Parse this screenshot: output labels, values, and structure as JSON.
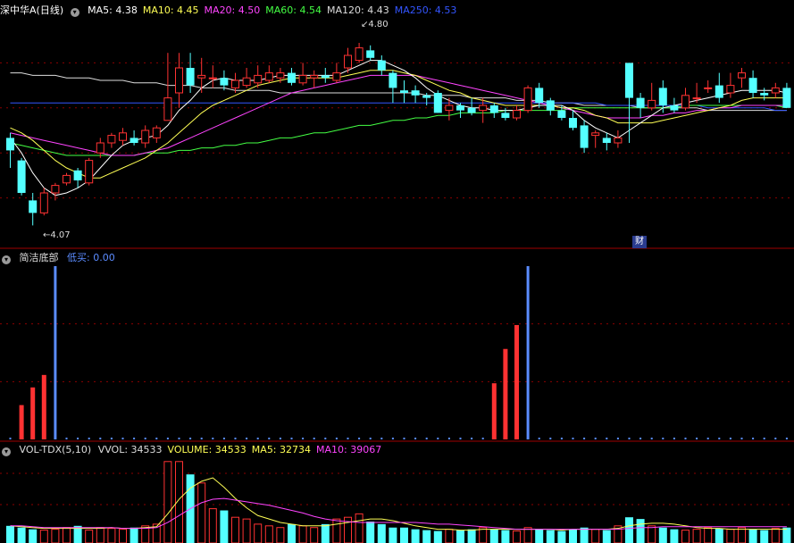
{
  "main_panel": {
    "title": "深中华A(日线)",
    "ma": [
      {
        "label": "MA5: 4.38",
        "color": "#ffffff"
      },
      {
        "label": "MA10: 4.45",
        "color": "#ffff55"
      },
      {
        "label": "MA20: 4.50",
        "color": "#ff44ff"
      },
      {
        "label": "MA60: 4.54",
        "color": "#44ff44"
      },
      {
        "label": "MA120: 4.43",
        "color": "#dddddd"
      },
      {
        "label": "MA250: 4.53",
        "color": "#3355ff"
      }
    ],
    "high_label": "4.80",
    "low_label": "4.07",
    "badge": "财"
  },
  "indicator_panel": {
    "name": "简洁底部",
    "value_label": "低买: 0.00",
    "value_color": "#5b8cff"
  },
  "volume_panel": {
    "name": "VOL-TDX(5,10)",
    "items": [
      {
        "label": "VVOL: 34533",
        "color": "#dddddd"
      },
      {
        "label": "VOLUME: 34533",
        "color": "#ffff55"
      },
      {
        "label": "MA5: 32734",
        "color": "#ffff55"
      },
      {
        "label": "MA10: 39067",
        "color": "#ff44ff"
      }
    ]
  },
  "colors": {
    "up": "#ff3232",
    "down": "#54ffff",
    "grid": "#8b0000",
    "buy_line": "#5b8cff"
  },
  "chart_data": {
    "type": "candlestick",
    "price_range": [
      4.0,
      4.9
    ],
    "candles": [
      [
        4.42,
        4.37,
        4.44,
        4.3
      ],
      [
        4.33,
        4.2,
        4.34,
        4.19
      ],
      [
        4.17,
        4.12,
        4.2,
        4.07
      ],
      [
        4.12,
        4.2,
        4.22,
        4.11
      ],
      [
        4.2,
        4.23,
        4.24,
        4.17
      ],
      [
        4.24,
        4.27,
        4.28,
        4.23
      ],
      [
        4.29,
        4.25,
        4.3,
        4.22
      ],
      [
        4.24,
        4.33,
        4.34,
        4.23
      ],
      [
        4.36,
        4.4,
        4.42,
        4.34
      ],
      [
        4.4,
        4.43,
        4.44,
        4.38
      ],
      [
        4.41,
        4.44,
        4.46,
        4.39
      ],
      [
        4.42,
        4.4,
        4.45,
        4.39
      ],
      [
        4.4,
        4.45,
        4.47,
        4.38
      ],
      [
        4.42,
        4.46,
        4.47,
        4.4
      ],
      [
        4.49,
        4.58,
        4.76,
        4.49
      ],
      [
        4.6,
        4.7,
        4.76,
        4.54
      ],
      [
        4.7,
        4.63,
        4.76,
        4.6
      ],
      [
        4.66,
        4.67,
        4.74,
        4.6
      ],
      [
        4.66,
        4.66,
        4.71,
        4.62
      ],
      [
        4.66,
        4.63,
        4.69,
        4.61
      ],
      [
        4.62,
        4.65,
        4.68,
        4.6
      ],
      [
        4.63,
        4.66,
        4.7,
        4.62
      ],
      [
        4.64,
        4.67,
        4.71,
        4.62
      ],
      [
        4.65,
        4.68,
        4.71,
        4.64
      ],
      [
        4.66,
        4.68,
        4.7,
        4.64
      ],
      [
        4.68,
        4.64,
        4.7,
        4.63
      ],
      [
        4.64,
        4.67,
        4.72,
        4.63
      ],
      [
        4.66,
        4.67,
        4.69,
        4.62
      ],
      [
        4.67,
        4.66,
        4.7,
        4.64
      ],
      [
        4.65,
        4.68,
        4.72,
        4.64
      ],
      [
        4.7,
        4.75,
        4.78,
        4.68
      ],
      [
        4.73,
        4.78,
        4.8,
        4.72
      ],
      [
        4.77,
        4.74,
        4.79,
        4.73
      ],
      [
        4.73,
        4.69,
        4.75,
        4.67
      ],
      [
        4.68,
        4.62,
        4.69,
        4.56
      ],
      [
        4.61,
        4.6,
        4.65,
        4.56
      ],
      [
        4.61,
        4.59,
        4.63,
        4.56
      ],
      [
        4.59,
        4.58,
        4.6,
        4.55
      ],
      [
        4.6,
        4.52,
        4.61,
        4.52
      ],
      [
        4.53,
        4.55,
        4.58,
        4.49
      ],
      [
        4.55,
        4.53,
        4.56,
        4.5
      ],
      [
        4.54,
        4.52,
        4.58,
        4.51
      ],
      [
        4.53,
        4.55,
        4.58,
        4.48
      ],
      [
        4.55,
        4.52,
        4.56,
        4.5
      ],
      [
        4.52,
        4.5,
        4.54,
        4.49
      ],
      [
        4.5,
        4.53,
        4.55,
        4.49
      ],
      [
        4.53,
        4.62,
        4.63,
        4.52
      ],
      [
        4.62,
        4.56,
        4.64,
        4.54
      ],
      [
        4.57,
        4.53,
        4.58,
        4.51
      ],
      [
        4.53,
        4.5,
        4.55,
        4.49
      ],
      [
        4.5,
        4.46,
        4.53,
        4.45
      ],
      [
        4.47,
        4.38,
        4.49,
        4.36
      ],
      [
        4.43,
        4.44,
        4.45,
        4.38
      ],
      [
        4.42,
        4.4,
        4.44,
        4.37
      ],
      [
        4.4,
        4.42,
        4.45,
        4.38
      ],
      [
        4.72,
        4.58,
        4.72,
        4.4
      ],
      [
        4.58,
        4.54,
        4.6,
        4.5
      ],
      [
        4.54,
        4.57,
        4.64,
        4.53
      ],
      [
        4.62,
        4.55,
        4.65,
        4.52
      ],
      [
        4.55,
        4.53,
        4.58,
        4.52
      ],
      [
        4.54,
        4.59,
        4.62,
        4.53
      ],
      [
        4.58,
        4.58,
        4.64,
        4.56
      ],
      [
        4.62,
        4.62,
        4.65,
        4.6
      ],
      [
        4.63,
        4.58,
        4.68,
        4.56
      ],
      [
        4.6,
        4.63,
        4.68,
        4.58
      ],
      [
        4.66,
        4.68,
        4.7,
        4.62
      ],
      [
        4.66,
        4.6,
        4.69,
        4.58
      ],
      [
        4.6,
        4.59,
        4.62,
        4.57
      ],
      [
        4.6,
        4.62,
        4.64,
        4.58
      ],
      [
        4.62,
        4.54,
        4.64,
        4.54
      ]
    ],
    "ma5": [
      4.42,
      4.36,
      4.28,
      4.22,
      4.19,
      4.2,
      4.22,
      4.25,
      4.3,
      4.35,
      4.39,
      4.41,
      4.42,
      4.43,
      4.47,
      4.53,
      4.57,
      4.62,
      4.65,
      4.66,
      4.65,
      4.65,
      4.65,
      4.66,
      4.67,
      4.67,
      4.67,
      4.67,
      4.67,
      4.67,
      4.69,
      4.71,
      4.73,
      4.73,
      4.71,
      4.69,
      4.66,
      4.62,
      4.59,
      4.57,
      4.55,
      4.54,
      4.54,
      4.53,
      4.53,
      4.53,
      4.54,
      4.55,
      4.55,
      4.55,
      4.53,
      4.49,
      4.46,
      4.44,
      4.42,
      4.45,
      4.48,
      4.51,
      4.54,
      4.55,
      4.56,
      4.57,
      4.58,
      4.59,
      4.6,
      4.61,
      4.61,
      4.61,
      4.61,
      4.6
    ],
    "ma10": [
      4.46,
      4.44,
      4.41,
      4.37,
      4.33,
      4.3,
      4.28,
      4.26,
      4.26,
      4.28,
      4.3,
      4.32,
      4.34,
      4.37,
      4.4,
      4.44,
      4.48,
      4.52,
      4.55,
      4.57,
      4.59,
      4.61,
      4.63,
      4.64,
      4.65,
      4.66,
      4.66,
      4.66,
      4.66,
      4.66,
      4.67,
      4.68,
      4.69,
      4.69,
      4.69,
      4.68,
      4.67,
      4.65,
      4.63,
      4.61,
      4.6,
      4.58,
      4.57,
      4.56,
      4.55,
      4.55,
      4.55,
      4.55,
      4.55,
      4.54,
      4.54,
      4.53,
      4.51,
      4.5,
      4.48,
      4.48,
      4.48,
      4.48,
      4.49,
      4.5,
      4.51,
      4.52,
      4.53,
      4.54,
      4.55,
      4.57,
      4.58,
      4.58,
      4.58,
      4.58
    ],
    "ma20": [
      4.44,
      4.43,
      4.42,
      4.41,
      4.4,
      4.39,
      4.38,
      4.37,
      4.36,
      4.35,
      4.35,
      4.35,
      4.36,
      4.37,
      4.38,
      4.4,
      4.42,
      4.44,
      4.46,
      4.48,
      4.5,
      4.52,
      4.54,
      4.56,
      4.58,
      4.6,
      4.61,
      4.62,
      4.63,
      4.64,
      4.65,
      4.66,
      4.67,
      4.67,
      4.67,
      4.67,
      4.67,
      4.66,
      4.65,
      4.64,
      4.63,
      4.62,
      4.61,
      4.6,
      4.59,
      4.58,
      4.57,
      4.56,
      4.55,
      4.54,
      4.53,
      4.52,
      4.51,
      4.5,
      4.5,
      4.5,
      4.5,
      4.51,
      4.51,
      4.52,
      4.52,
      4.53,
      4.53,
      4.54,
      4.54,
      4.55,
      4.55,
      4.55,
      4.55,
      4.55
    ],
    "ma60": [
      4.4,
      4.39,
      4.38,
      4.37,
      4.36,
      4.35,
      4.35,
      4.35,
      4.35,
      4.35,
      4.35,
      4.35,
      4.36,
      4.36,
      4.36,
      4.37,
      4.37,
      4.38,
      4.38,
      4.39,
      4.39,
      4.4,
      4.4,
      4.41,
      4.42,
      4.42,
      4.43,
      4.44,
      4.44,
      4.45,
      4.46,
      4.47,
      4.47,
      4.48,
      4.49,
      4.49,
      4.5,
      4.5,
      4.51,
      4.51,
      4.52,
      4.52,
      4.52,
      4.52,
      4.53,
      4.53,
      4.53,
      4.53,
      4.53,
      4.53,
      4.54,
      4.54,
      4.54,
      4.54,
      4.54,
      4.54,
      4.54,
      4.54,
      4.54,
      4.54,
      4.55,
      4.55,
      4.55,
      4.55,
      4.55,
      4.55,
      4.55,
      4.55,
      4.55,
      4.54
    ],
    "ma120": [
      4.68,
      4.68,
      4.67,
      4.67,
      4.67,
      4.66,
      4.66,
      4.66,
      4.65,
      4.65,
      4.65,
      4.64,
      4.64,
      4.64,
      4.63,
      4.63,
      4.63,
      4.62,
      4.62,
      4.62,
      4.61,
      4.61,
      4.61,
      4.61,
      4.6,
      4.6,
      4.6,
      4.6,
      4.6,
      4.6,
      4.6,
      4.6,
      4.6,
      4.6,
      4.6,
      4.6,
      4.6,
      4.59,
      4.59,
      4.59,
      4.59,
      4.58,
      4.58,
      4.58,
      4.58,
      4.57,
      4.57,
      4.57,
      4.56,
      4.56,
      4.56,
      4.55,
      4.55,
      4.55,
      4.55,
      4.55,
      4.54,
      4.54,
      4.54,
      4.54,
      4.54,
      4.54,
      4.53,
      4.53,
      4.53,
      4.53,
      4.53,
      4.53,
      4.53,
      4.53
    ],
    "ma250": [
      4.56,
      4.56,
      4.56,
      4.56,
      4.56,
      4.56,
      4.56,
      4.56,
      4.56,
      4.56,
      4.56,
      4.56,
      4.56,
      4.56,
      4.56,
      4.56,
      4.56,
      4.56,
      4.56,
      4.56,
      4.56,
      4.56,
      4.56,
      4.56,
      4.56,
      4.56,
      4.56,
      4.56,
      4.56,
      4.56,
      4.56,
      4.56,
      4.56,
      4.56,
      4.56,
      4.56,
      4.56,
      4.56,
      4.56,
      4.56,
      4.56,
      4.56,
      4.56,
      4.56,
      4.56,
      4.56,
      4.56,
      4.56,
      4.56,
      4.56,
      4.56,
      4.56,
      4.56,
      4.55,
      4.55,
      4.55,
      4.55,
      4.55,
      4.55,
      4.55,
      4.55,
      4.55,
      4.54,
      4.54,
      4.54,
      4.54,
      4.54,
      4.54,
      4.53,
      4.53
    ],
    "signal_bars": [
      {
        "index": 1,
        "value": 0.33
      },
      {
        "index": 2,
        "value": 0.5
      },
      {
        "index": 3,
        "value": 0.62
      },
      {
        "index": 43,
        "value": 0.54
      },
      {
        "index": 44,
        "value": 0.87
      },
      {
        "index": 45,
        "value": 1.1
      }
    ],
    "buy_lines": [
      4,
      46
    ],
    "volume": [
      20,
      18,
      16,
      15,
      16,
      18,
      20,
      15,
      18,
      17,
      16,
      18,
      20,
      22,
      95,
      95,
      80,
      70,
      40,
      38,
      30,
      28,
      22,
      20,
      18,
      22,
      20,
      18,
      22,
      28,
      30,
      34,
      25,
      22,
      18,
      18,
      16,
      15,
      14,
      16,
      15,
      16,
      18,
      16,
      15,
      14,
      18,
      16,
      15,
      14,
      16,
      18,
      16,
      15,
      20,
      30,
      28,
      20,
      18,
      16,
      15,
      16,
      18,
      17,
      16,
      18,
      16,
      15,
      17,
      18
    ],
    "vol_ma5": [
      20,
      19,
      18,
      17,
      17,
      17,
      17,
      17,
      17,
      18,
      17,
      17,
      18,
      19,
      34,
      51,
      64,
      72,
      76,
      65,
      52,
      41,
      32,
      28,
      24,
      22,
      20,
      20,
      20,
      22,
      24,
      26,
      28,
      28,
      26,
      23,
      20,
      18,
      16,
      16,
      15,
      15,
      16,
      16,
      16,
      16,
      16,
      16,
      16,
      15,
      16,
      16,
      16,
      16,
      17,
      20,
      22,
      23,
      23,
      22,
      20,
      18,
      17,
      17,
      16,
      16,
      16,
      16,
      16,
      16
    ],
    "vol_ma10": [
      20,
      20,
      19,
      18,
      18,
      18,
      18,
      18,
      18,
      18,
      17,
      17,
      17,
      18,
      24,
      32,
      40,
      47,
      51,
      52,
      50,
      48,
      46,
      44,
      41,
      38,
      35,
      31,
      28,
      26,
      25,
      24,
      24,
      24,
      24,
      24,
      24,
      23,
      22,
      22,
      21,
      20,
      19,
      18,
      17,
      16,
      16,
      16,
      16,
      16,
      16,
      16,
      16,
      16,
      16,
      17,
      18,
      18,
      19,
      19,
      19,
      19,
      19,
      19,
      19,
      19,
      19,
      19,
      19,
      19
    ],
    "volume_range": [
      0,
      100
    ]
  }
}
